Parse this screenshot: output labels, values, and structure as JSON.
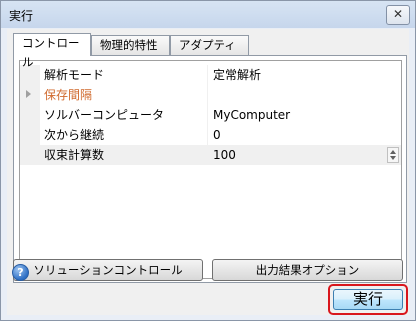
{
  "window": {
    "title": "実行",
    "close_glyph": "✕"
  },
  "tabs": [
    {
      "label": "コントロール",
      "active": true
    },
    {
      "label": "物理的特性",
      "active": false
    },
    {
      "label": "アダプティブ",
      "active": false
    }
  ],
  "properties": [
    {
      "name": "解析モード",
      "value": "定常解析"
    },
    {
      "name": "保存間隔",
      "value": "",
      "category": true,
      "collapsed": true
    },
    {
      "name": "ソルバーコンピュータ",
      "value": "MyComputer"
    },
    {
      "name": "次から継続",
      "value": "0"
    },
    {
      "name": "収束計算数",
      "value": "100",
      "selected": true,
      "spinner": true
    }
  ],
  "buttons": {
    "solution_control": "ソリューションコントロール",
    "output_options": "出力結果オプション",
    "run": "実行"
  },
  "help_glyph": "?",
  "colors": {
    "category_text": "#d06a2e",
    "highlight": "#d9161c"
  }
}
